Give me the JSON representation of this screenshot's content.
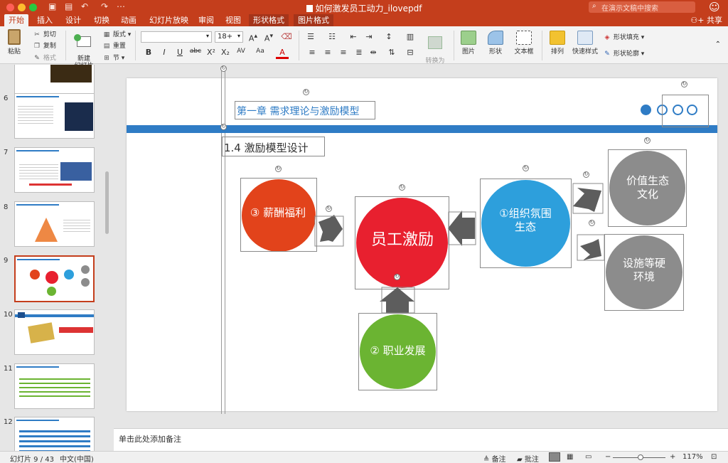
{
  "app": {
    "title": "如何激发员工动力_ilovepdf",
    "search_placeholder": "在演示文稿中搜索",
    "share_label": "共享"
  },
  "tabs": [
    {
      "label": "开始",
      "active": true
    },
    {
      "label": "插入"
    },
    {
      "label": "设计"
    },
    {
      "label": "切换"
    },
    {
      "label": "动画"
    },
    {
      "label": "幻灯片放映"
    },
    {
      "label": "审阅"
    },
    {
      "label": "视图"
    },
    {
      "label": "形状格式",
      "contextual": true
    },
    {
      "label": "图片格式",
      "contextual": true
    }
  ],
  "ribbon": {
    "paste": "粘贴",
    "cut": "剪切",
    "copy": "复制",
    "format": "格式",
    "new_slide": "新建\n幻灯片",
    "layout": "版式",
    "reset": "重置",
    "section": "节",
    "font_size": "18+",
    "font_name": "",
    "convert_smartart": "转换为\nSmartArt",
    "picture": "图片",
    "shape": "形状",
    "textbox": "文本框",
    "arrange": "排列",
    "quick_styles": "快速样式",
    "shape_fill": "形状填充",
    "shape_outline": "形状轮廓"
  },
  "thumbnails": [
    {
      "num": "6"
    },
    {
      "num": "7"
    },
    {
      "num": "8"
    },
    {
      "num": "9",
      "selected": true
    },
    {
      "num": "10"
    },
    {
      "num": "11"
    },
    {
      "num": "12"
    }
  ],
  "slide": {
    "header": "第一章 需求理论与激励模型",
    "subtitle": "1.4 激励模型设计",
    "center": "员工激励",
    "salary": "③ 薪酬福利",
    "atmosphere": "①组织氛围\n生态",
    "career": "② 职业发展",
    "value_culture": "价值生态\n文化",
    "facility": "设施等硬\n环境",
    "colors": {
      "header_blue": "#2f7cc5",
      "center_red": "#e8202f",
      "salary_orange": "#e2431b",
      "atmosphere_blue": "#2d9fdc",
      "career_green": "#6bb432",
      "gray": "#8c8c8c",
      "arrow_gray": "#5d5d5d"
    }
  },
  "notes_placeholder": "单击此处添加备注",
  "status": {
    "slide_info": "幻灯片 9 / 43",
    "language": "中文(中国)",
    "notes": "备注",
    "comments": "批注",
    "zoom": "117%"
  }
}
